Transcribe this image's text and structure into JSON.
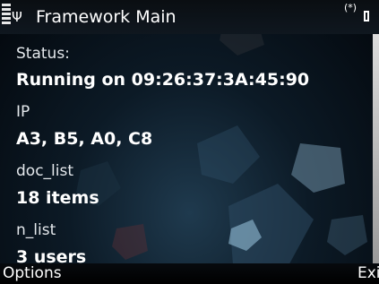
{
  "status_bar": {
    "title": "Framework Main",
    "antenna_icon": "antenna-icon",
    "bluetooth_indicator": "(*)",
    "battery_icon": "battery-icon"
  },
  "fields": [
    {
      "label": "Status:",
      "value": "Running on 09:26:37:3A:45:90"
    },
    {
      "label": "IP",
      "value": "A3, B5, A0, C8"
    },
    {
      "label": "doc_list",
      "value": "18 items"
    },
    {
      "label": "n_list",
      "value": "3 users"
    }
  ],
  "softkeys": {
    "left": "Options",
    "right": "Exit"
  },
  "colors": {
    "background_dark": "#03070c",
    "background_glow": "#1f3a4e",
    "text": "#ffffff"
  }
}
